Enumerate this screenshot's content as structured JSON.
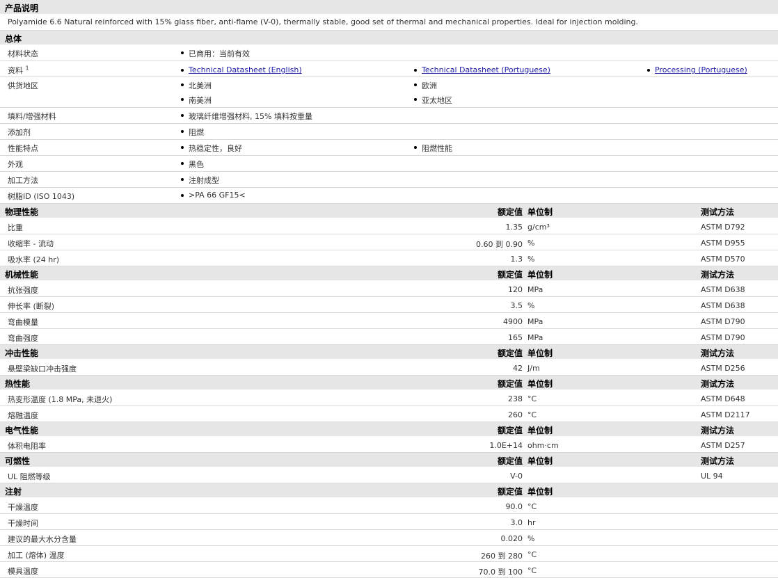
{
  "description": {
    "header": "产品说明",
    "text": "Polyamide 6.6 Natural reinforced with 15% glass fiber, anti-flame (V-0), thermally stable, good set of thermal and mechanical properties. Ideal for injection molding."
  },
  "general": {
    "header": "总体",
    "material_status": {
      "label": "材料状态",
      "value": "已商用：当前有效"
    },
    "literature": {
      "label": "资料",
      "sup": "1",
      "links": [
        "Technical Datasheet (English)",
        "Technical Datasheet (Portuguese)",
        "Processing (Portuguese)"
      ]
    },
    "availability": {
      "label": "供货地区",
      "values": [
        "北美洲",
        "欧洲",
        "南美洲",
        "亚太地区"
      ]
    },
    "filler": {
      "label": "填料/增强材料",
      "value": "玻璃纤维增强材料, 15% 填料按重量"
    },
    "additive": {
      "label": "添加剂",
      "value": "阻燃"
    },
    "features": {
      "label": "性能特点",
      "values": [
        "热稳定性，良好",
        "阻燃性能"
      ]
    },
    "appearance": {
      "label": "外观",
      "value": "黑色"
    },
    "processing": {
      "label": "加工方法",
      "value": "注射成型"
    },
    "resin_id": {
      "label": "树脂ID (ISO 1043)",
      "value": ">PA 66 GF15<"
    }
  },
  "sections": [
    {
      "title": "物理性能",
      "col_nominal": "额定值",
      "col_unit": "单位制",
      "col_method": "测试方法",
      "rows": [
        {
          "name": "比重",
          "value": "1.35",
          "unit": "g/cm³",
          "method": "ASTM D792"
        },
        {
          "name": "收缩率 - 流动",
          "value": "0.60 到  0.90",
          "unit": "%",
          "method": "ASTM D955"
        },
        {
          "name": "吸水率 (24 hr)",
          "value": "1.3",
          "unit": "%",
          "method": "ASTM D570"
        }
      ]
    },
    {
      "title": "机械性能",
      "col_nominal": "额定值",
      "col_unit": "单位制",
      "col_method": "测试方法",
      "rows": [
        {
          "name": "抗张强度",
          "value": "120",
          "unit": "MPa",
          "method": "ASTM D638"
        },
        {
          "name": "伸长率 (断裂)",
          "value": "3.5",
          "unit": "%",
          "method": "ASTM D638"
        },
        {
          "name": "弯曲模量",
          "value": "4900",
          "unit": "MPa",
          "method": "ASTM D790"
        },
        {
          "name": "弯曲强度",
          "value": "165",
          "unit": "MPa",
          "method": "ASTM D790"
        }
      ]
    },
    {
      "title": "冲击性能",
      "col_nominal": "额定值",
      "col_unit": "单位制",
      "col_method": "测试方法",
      "rows": [
        {
          "name": "悬壁梁缺口冲击强度",
          "value": "42",
          "unit": "J/m",
          "method": "ASTM D256"
        }
      ]
    },
    {
      "title": "热性能",
      "col_nominal": "额定值",
      "col_unit": "单位制",
      "col_method": "测试方法",
      "rows": [
        {
          "name": "热变形温度 (1.8 MPa, 未退火)",
          "value": "238",
          "unit": "°C",
          "method": "ASTM D648"
        },
        {
          "name": "熔融温度",
          "value": "260",
          "unit": "°C",
          "method": "ASTM D2117"
        }
      ]
    },
    {
      "title": "电气性能",
      "col_nominal": "额定值",
      "col_unit": "单位制",
      "col_method": "测试方法",
      "rows": [
        {
          "name": "体积电阻率",
          "value": "1.0E+14",
          "unit": "ohm·cm",
          "method": "ASTM D257"
        }
      ]
    },
    {
      "title": "可燃性",
      "col_nominal": "额定值",
      "col_unit": "单位制",
      "col_method": "测试方法",
      "rows": [
        {
          "name": "UL 阻燃等级",
          "value": "V-0",
          "unit": "",
          "method": "UL 94"
        }
      ]
    },
    {
      "title": "注射",
      "col_nominal": "额定值",
      "col_unit": "单位制",
      "col_method": "",
      "rows": [
        {
          "name": "干燥温度",
          "value": "90.0",
          "unit": "°C",
          "method": ""
        },
        {
          "name": "干燥时间",
          "value": "3.0",
          "unit": "hr",
          "method": ""
        },
        {
          "name": "建议的最大水分含量",
          "value": "0.020",
          "unit": "%",
          "method": ""
        },
        {
          "name": "加工 (熔体) 温度",
          "value": "260 到  280",
          "unit": "°C",
          "method": ""
        },
        {
          "name": "模具温度",
          "value": "70.0 到  100",
          "unit": "°C",
          "method": ""
        }
      ]
    }
  ]
}
